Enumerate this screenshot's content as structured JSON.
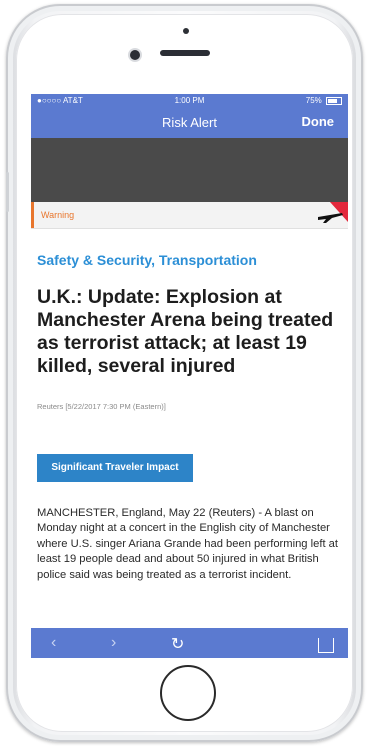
{
  "status_bar": {
    "carrier": "●○○○○ AT&T",
    "time": "1:00 PM",
    "battery": "75%"
  },
  "nav_bar": {
    "title": "Risk Alert",
    "done_label": "Done"
  },
  "alert": {
    "level": "Warning",
    "category": "Safety & Security, Transportation",
    "headline": "U.K.: Update: Explosion at Manchester Arena being treated as terrorist attack; at least 19 killed, several injured",
    "source": "Reuters [5/22/2017 7:30 PM (Eastern)]",
    "impact_button": "Significant Traveler Impact",
    "body": "MANCHESTER, England, May 22 (Reuters) - A blast on Monday night at a concert in the English city of Manchester where U.S. singer Ariana Grande had been performing left at least 19 people dead and about 50 injured in what British police said was being treated as a terrorist incident."
  },
  "toolbar": {
    "back_icon": "chevron-left-icon",
    "forward_icon": "chevron-right-icon",
    "reload_icon": "reload-icon",
    "share_icon": "share-icon"
  },
  "colors": {
    "nav_blue": "#5b7ad0",
    "warning_orange": "#e8762d",
    "category_blue": "#2c8fd6",
    "impact_blue": "#2d84c8"
  }
}
